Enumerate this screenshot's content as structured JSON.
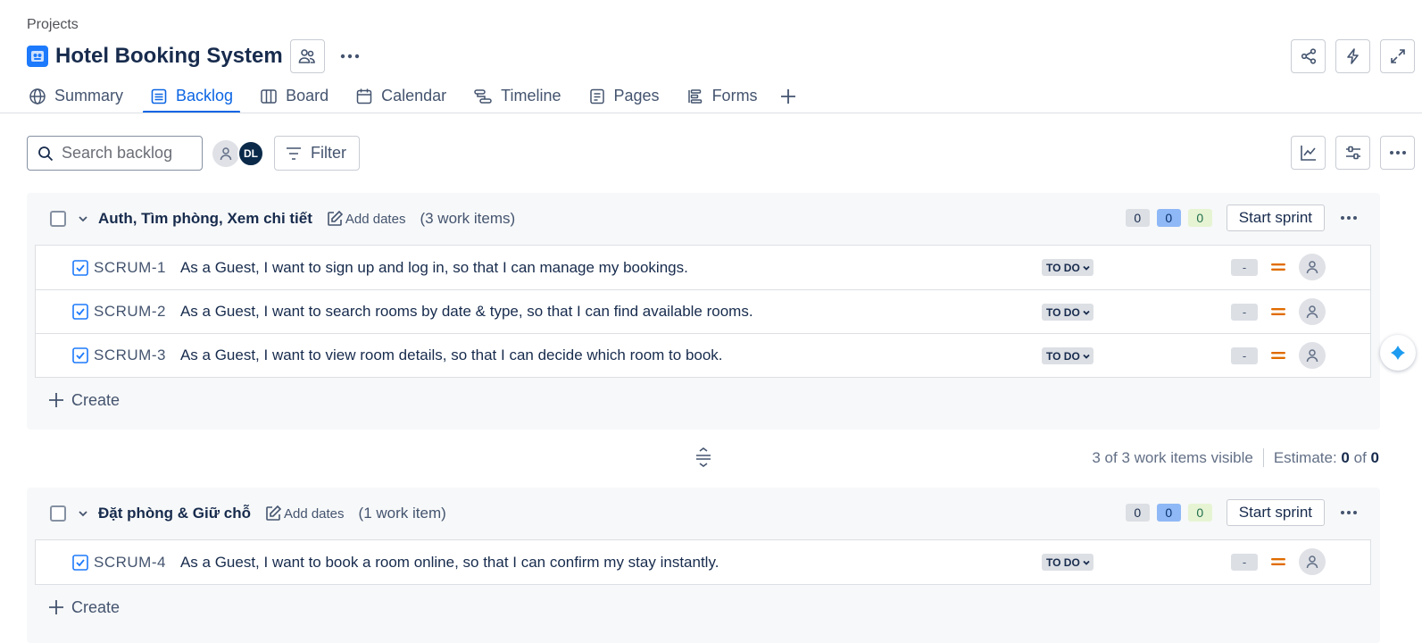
{
  "breadcrumb": "Projects",
  "project": {
    "title": "Hotel Booking System",
    "icon": "project-avatar-icon"
  },
  "tabs": [
    {
      "label": "Summary",
      "icon": "globe-icon"
    },
    {
      "label": "Backlog",
      "icon": "list-icon",
      "active": true
    },
    {
      "label": "Board",
      "icon": "board-icon"
    },
    {
      "label": "Calendar",
      "icon": "calendar-icon"
    },
    {
      "label": "Timeline",
      "icon": "timeline-icon"
    },
    {
      "label": "Pages",
      "icon": "page-icon"
    },
    {
      "label": "Forms",
      "icon": "forms-icon"
    }
  ],
  "toolbar": {
    "search_placeholder": "Search backlog",
    "avatar_initials": "DL",
    "filter_label": "Filter"
  },
  "sprints": [
    {
      "name": "Auth, Tìm phòng, Xem chi tiết",
      "add_dates": "Add dates",
      "count": "(3 work items)",
      "pills": [
        "0",
        "0",
        "0"
      ],
      "start_label": "Start sprint",
      "issues": [
        {
          "key": "SCRUM-1",
          "summary": "As a Guest, I want to sign up and log in, so that I can manage my bookings.",
          "status": "TO DO",
          "estimate": "-"
        },
        {
          "key": "SCRUM-2",
          "summary": "As a Guest, I want to search rooms by date & type, so that I can find available rooms.",
          "status": "TO DO",
          "estimate": "-"
        },
        {
          "key": "SCRUM-3",
          "summary": "As a Guest, I want to view room details, so that I can decide which room to book.",
          "status": "TO DO",
          "estimate": "-"
        }
      ],
      "create_label": "Create"
    },
    {
      "name": "Đặt phòng & Giữ chỗ",
      "add_dates": "Add dates",
      "count": "(1 work item)",
      "pills": [
        "0",
        "0",
        "0"
      ],
      "start_label": "Start sprint",
      "issues": [
        {
          "key": "SCRUM-4",
          "summary": "As a Guest, I want to book a room online, so that I can confirm my stay instantly.",
          "status": "TO DO",
          "estimate": "-"
        }
      ],
      "create_label": "Create"
    }
  ],
  "visibility": {
    "visible_text": "3 of 3 work items visible",
    "estimate_label": "Estimate:",
    "estimate_done": "0",
    "estimate_of": "of",
    "estimate_total": "0"
  },
  "colors": {
    "accent": "#0c66e4",
    "project_icon": "#1d7afc",
    "priority_medium": "#e06c00",
    "story_icon": "#1d7afc"
  }
}
